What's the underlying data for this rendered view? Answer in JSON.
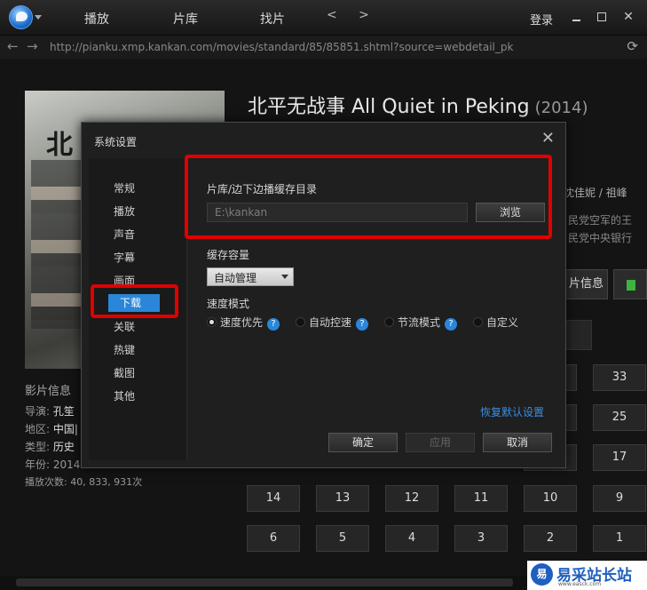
{
  "topbar": {
    "nav": [
      "播放",
      "片库",
      "找片"
    ],
    "arrows": "< >",
    "login": "登录",
    "min": "—",
    "close": "✕"
  },
  "addressbar": {
    "url": "http://pianku.xmp.kankan.com/movies/standard/85/85851.shtml?source=webdetail_pk"
  },
  "movie": {
    "poster_text": "北",
    "title": "北平无战事 All Quiet in Peking",
    "year": "(2014)",
    "cast_partial": "沈佳妮 / 祖峰",
    "desc_line1": "民党空军的王",
    "desc_line2": "民党中央银行",
    "info_button": "片信息",
    "info_title": "影片信息",
    "meta": [
      {
        "label": "导演:",
        "value": "孔笙"
      },
      {
        "label": "地区:",
        "value": "中国|"
      },
      {
        "label": "类型:",
        "value": "历史"
      },
      {
        "label": "年份:",
        "value": "2014"
      }
    ],
    "play_count": "播放次数: 40, 833, 931次"
  },
  "episodes": {
    "row1": [
      "33"
    ],
    "row2": [
      "25"
    ],
    "row3": [
      "17"
    ],
    "row4": [
      "14",
      "13",
      "12",
      "11",
      "10",
      "9"
    ],
    "row5": [
      "6",
      "5",
      "4",
      "3",
      "2",
      "1"
    ]
  },
  "dialog": {
    "title": "系统设置",
    "close": "✕",
    "sidebar": [
      "常规",
      "播放",
      "声音",
      "字幕",
      "画面",
      "下载",
      "关联",
      "热键",
      "截图",
      "其他"
    ],
    "active_index": 5,
    "cache_dir_label": "片库/边下边播缓存目录",
    "cache_dir_value": "E:\\kankan",
    "browse_button": "浏览",
    "capacity_label": "缓存容量",
    "capacity_value": "自动管理",
    "speed_label": "速度模式",
    "speed_options": [
      {
        "label": "速度优先",
        "checked": true,
        "help": true
      },
      {
        "label": "自动控速",
        "checked": false,
        "help": true
      },
      {
        "label": "节流模式",
        "checked": false,
        "help": true
      },
      {
        "label": "自定义",
        "checked": false,
        "help": false
      }
    ],
    "help_glyph": "?",
    "restore_link": "恢复默认设置",
    "ok_button": "确定",
    "apply_button": "应用",
    "cancel_button": "取消"
  },
  "watermark": {
    "badge": "易",
    "text": "易采站长站",
    "url": "www.easck.com"
  },
  "colors": {
    "highlight": "#e10000",
    "accent": "#2a86d8",
    "link": "#3a8fe0"
  }
}
